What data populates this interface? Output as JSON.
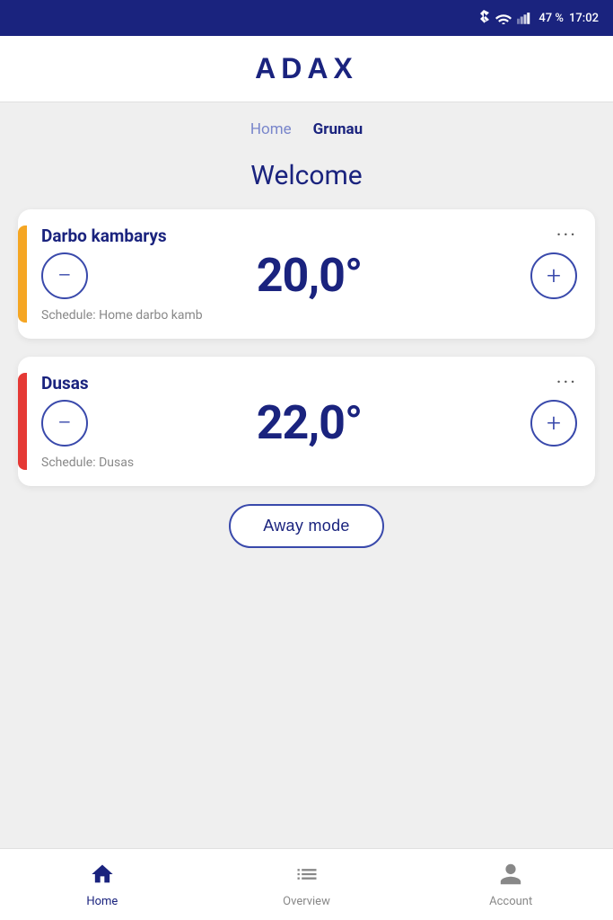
{
  "status_bar": {
    "battery": "47 %",
    "time": "17:02"
  },
  "header": {
    "logo": "ADAX"
  },
  "breadcrumb": {
    "items": [
      {
        "label": "Home",
        "active": false
      },
      {
        "label": "Grunau",
        "active": true
      }
    ]
  },
  "welcome": {
    "title": "Welcome"
  },
  "devices": [
    {
      "name": "Darbo kambarys",
      "temperature": "20,0°",
      "schedule": "Schedule: Home darbo kamb",
      "bar_color": "yellow"
    },
    {
      "name": "Dusas",
      "temperature": "22,0°",
      "schedule": "Schedule: Dusas",
      "bar_color": "red"
    }
  ],
  "away_mode_button": "Away mode",
  "bottom_nav": {
    "items": [
      {
        "label": "Home",
        "active": true,
        "icon": "home"
      },
      {
        "label": "Overview",
        "active": false,
        "icon": "list"
      },
      {
        "label": "Account",
        "active": false,
        "icon": "person"
      }
    ]
  }
}
